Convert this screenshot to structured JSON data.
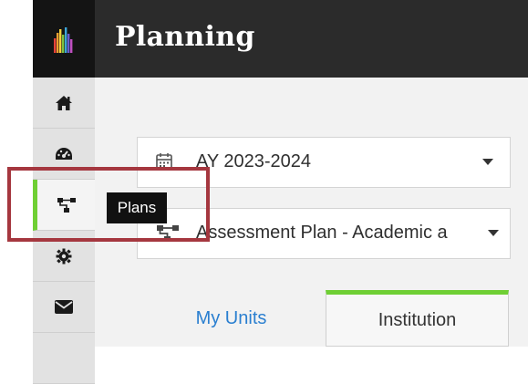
{
  "header": {
    "title": "Planning"
  },
  "sidebar": {
    "items": [
      {
        "name": "home",
        "icon": "home-icon"
      },
      {
        "name": "dashboard",
        "icon": "dashboard-icon"
      },
      {
        "name": "plans",
        "icon": "hierarchy-icon",
        "active": true
      },
      {
        "name": "settings",
        "icon": "gear-icon"
      },
      {
        "name": "messages",
        "icon": "envelope-icon"
      }
    ]
  },
  "tooltip": {
    "label": "Plans"
  },
  "filters": {
    "year": {
      "value": "AY 2023-2024",
      "icon": "calendar-icon"
    },
    "plan": {
      "value": "Assessment Plan - Academic a",
      "icon": "hierarchy-icon"
    }
  },
  "tabs": [
    {
      "label": "My Units",
      "active": false
    },
    {
      "label": "Institution",
      "active": true
    }
  ],
  "colors": {
    "accent": "#6fcf34",
    "link": "#2a7fd0",
    "highlight": "#a5373f",
    "header": "#2b2b2b"
  }
}
